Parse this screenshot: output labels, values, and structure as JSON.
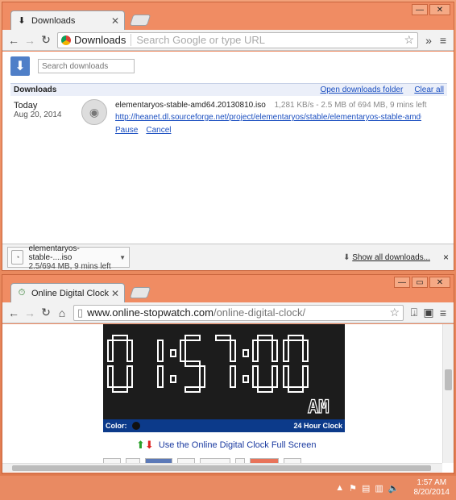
{
  "downloads_window": {
    "tab_title": "Downloads",
    "chip_label": "Downloads",
    "omnibox_placeholder": "Search Google or type URL",
    "search_placeholder": "Search downloads",
    "section_title": "Downloads",
    "open_folder_link": "Open downloads folder",
    "clear_all_link": "Clear all",
    "item": {
      "day": "Today",
      "date": "Aug 20, 2014",
      "filename": "elementaryos-stable-amd64.20130810.iso",
      "progress": "1,281 KB/s - 2.5 MB of 694 MB, 9 mins left",
      "url": "http://heanet.dl.sourceforge.net/project/elementaryos/stable/elementaryos-stable-amd64.2...",
      "pause_label": "Pause",
      "cancel_label": "Cancel"
    },
    "shelf": {
      "filename": "elementaryos-stable-....iso",
      "status": "2.5/694 MB, 9 mins left",
      "show_all_label": "Show all downloads...",
      "close_label": "×"
    }
  },
  "clock_window": {
    "tab_title": "Online Digital Clock",
    "url_host": "www.online-stopwatch.com",
    "url_path": "/online-digital-clock/",
    "clock": {
      "time": "01:57:00",
      "ampm": "AM"
    },
    "color_label": "Color:",
    "mode_label": "24 Hour Clock",
    "fullscreen_link": "Use the Online Digital Clock Full Screen"
  },
  "taskbar": {
    "time": "1:57 AM",
    "date": "8/20/2014"
  }
}
